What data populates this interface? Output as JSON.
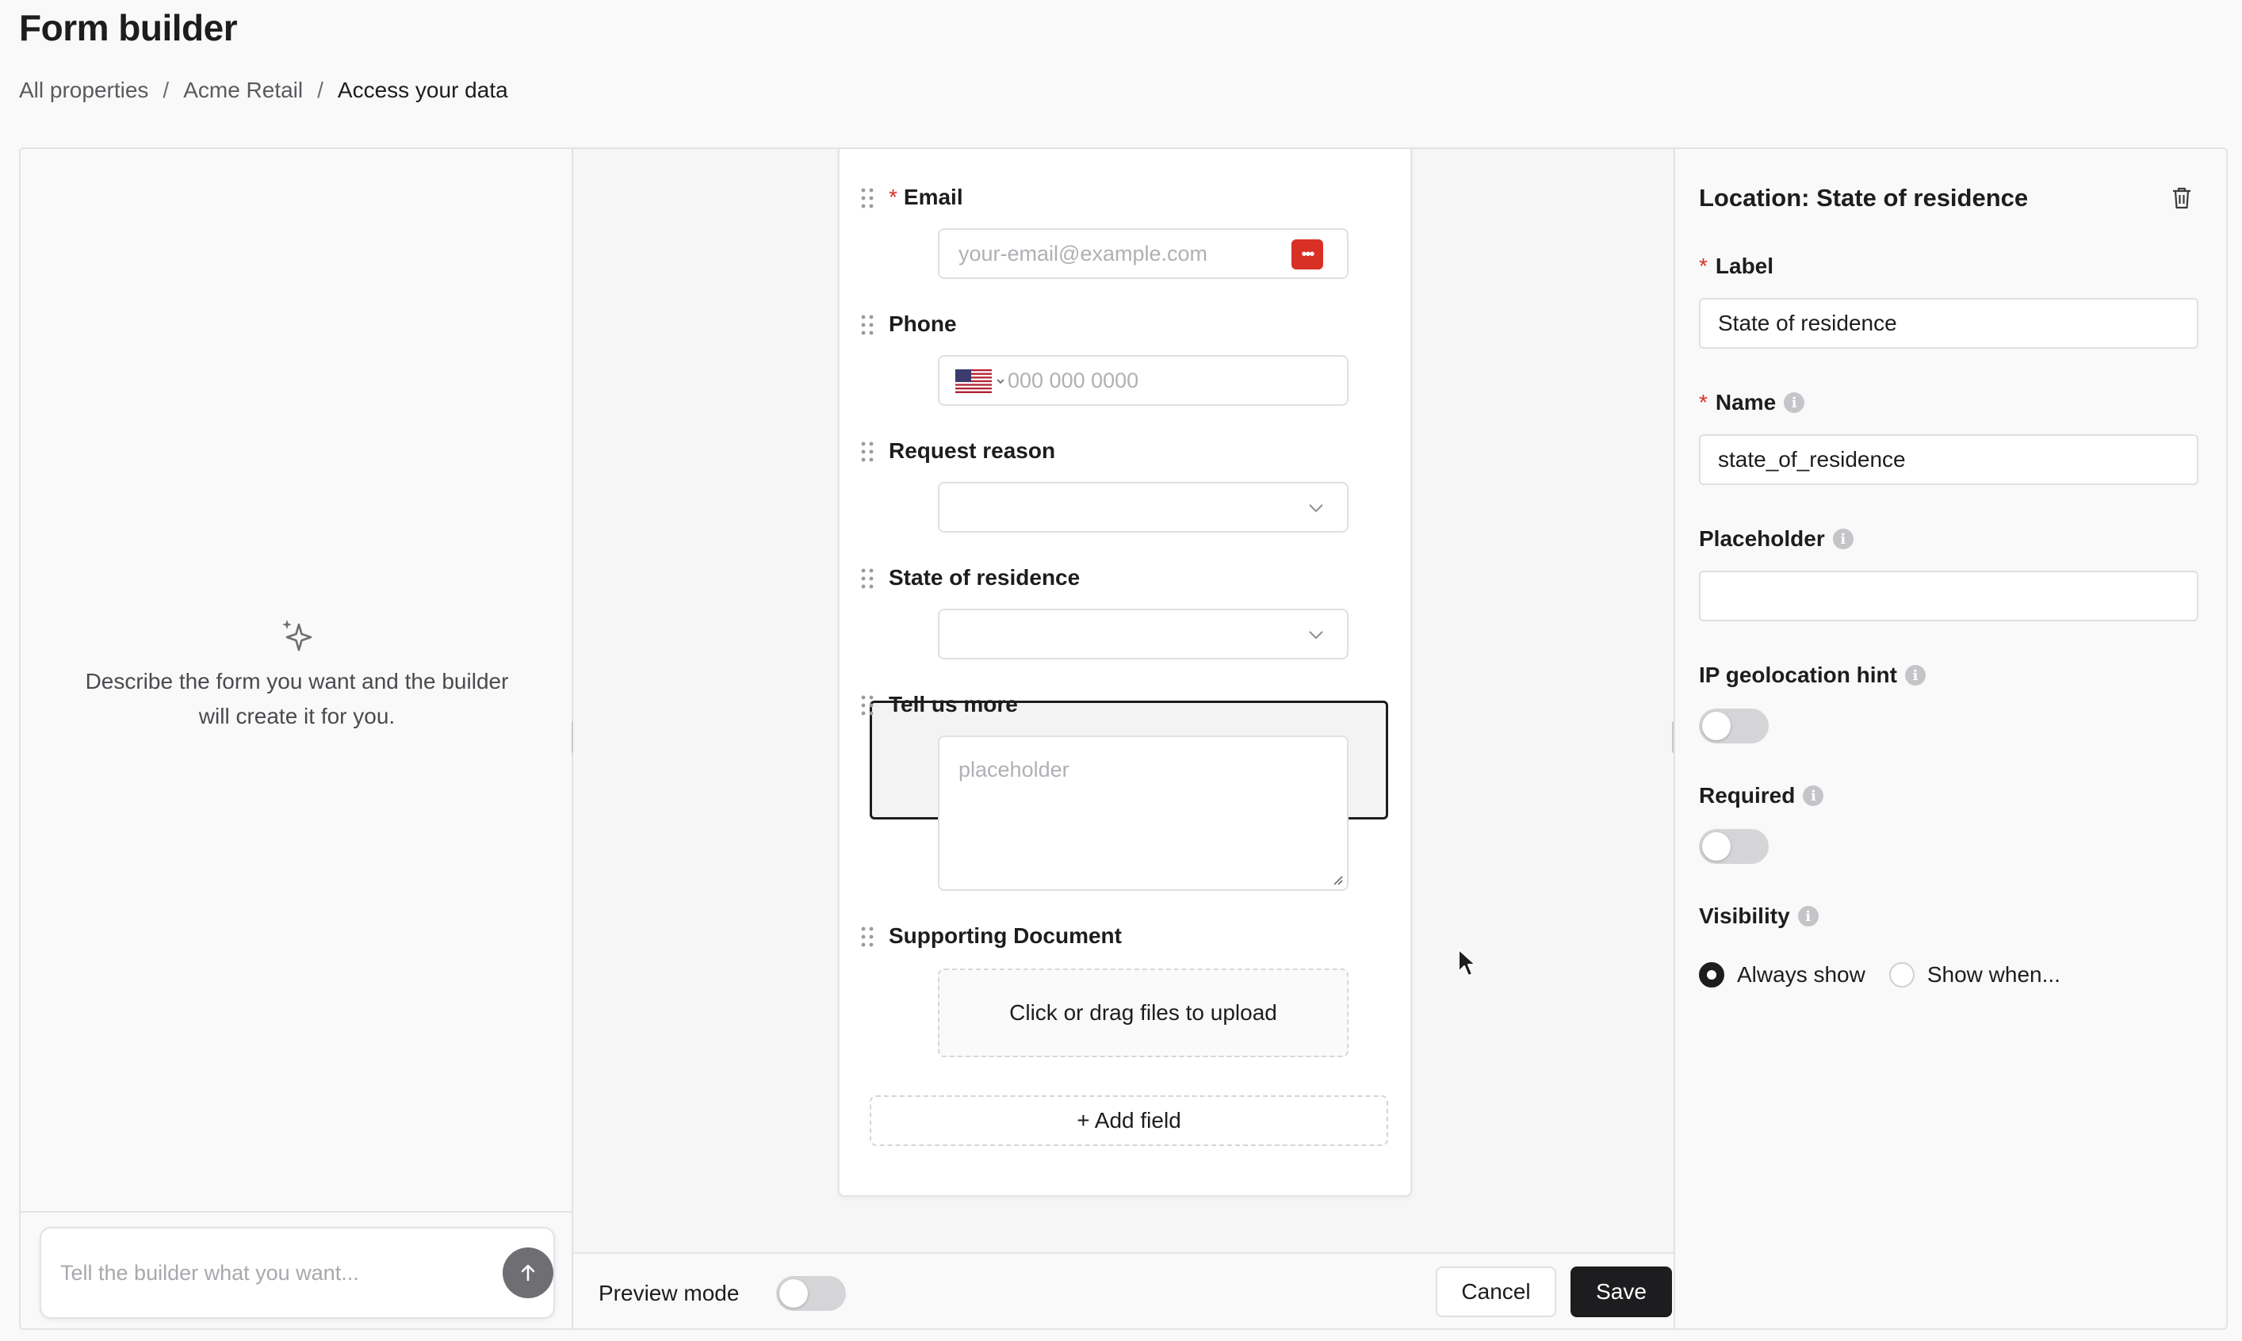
{
  "page": {
    "title": "Form builder"
  },
  "breadcrumb": {
    "items": [
      "All properties",
      "Acme Retail",
      "Access your data"
    ],
    "separator": "/"
  },
  "assistant": {
    "empty_text_line1": "Describe the form you want and the builder",
    "empty_text_line2": "will create it for you.",
    "input_placeholder": "Tell the builder what you want...",
    "icon": "sparkle-icon"
  },
  "form": {
    "fields": [
      {
        "label": "Email",
        "required": true,
        "type": "email",
        "placeholder": "your-email@example.com",
        "value": ""
      },
      {
        "label": "Phone",
        "required": false,
        "type": "phone",
        "placeholder": "000 000 0000",
        "country_flag": "US",
        "value": ""
      },
      {
        "label": "Request reason",
        "required": false,
        "type": "select",
        "value": ""
      },
      {
        "label": "State of residence",
        "required": false,
        "type": "select",
        "value": "",
        "selected": true
      },
      {
        "label": "Tell us more",
        "required": false,
        "type": "textarea",
        "placeholder": "placeholder",
        "value": ""
      },
      {
        "label": "Supporting Document",
        "required": false,
        "type": "file",
        "upload_text": "Click or drag files to upload"
      }
    ],
    "add_field_label": "+ Add field"
  },
  "footer": {
    "preview_label": "Preview mode",
    "preview_on": false,
    "cancel_label": "Cancel",
    "save_label": "Save"
  },
  "properties": {
    "title": "Location: State of residence",
    "label_label": "Label",
    "label_value": "State of residence",
    "name_label": "Name",
    "name_value": "state_of_residence",
    "placeholder_label": "Placeholder",
    "placeholder_value": "",
    "ip_hint_label": "IP geolocation hint",
    "ip_hint_on": false,
    "required_label": "Required",
    "required_on": false,
    "visibility_label": "Visibility",
    "visibility_options": [
      "Always show",
      "Show when..."
    ],
    "visibility_selected": "Always show"
  },
  "colors": {
    "accent": "#1d1d1f",
    "required": "#d93025",
    "border": "#e0e0e3",
    "background": "#f9f9f9"
  }
}
